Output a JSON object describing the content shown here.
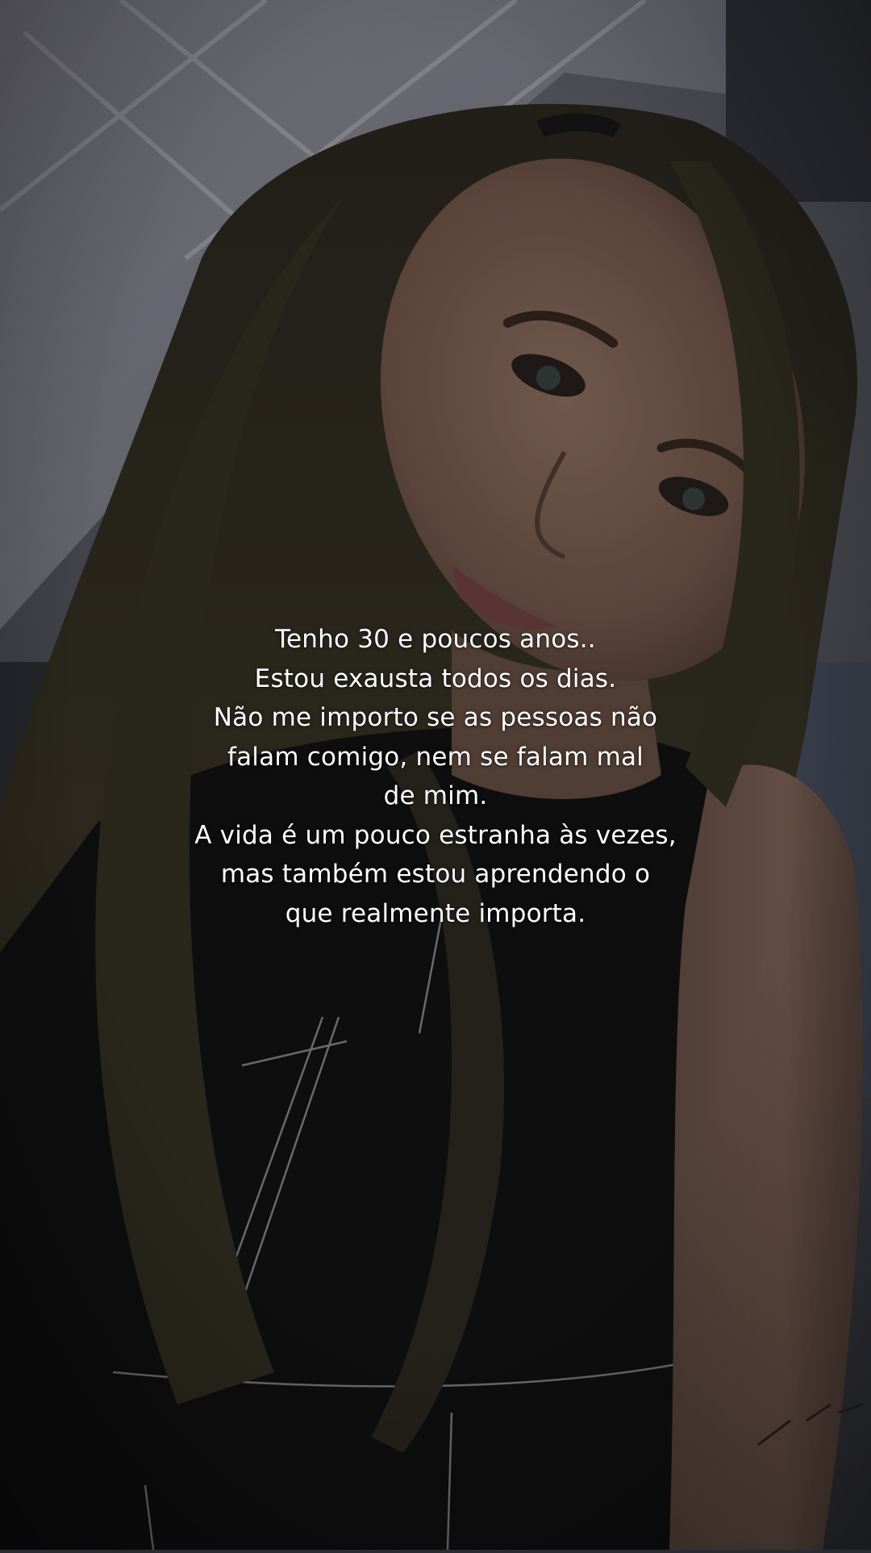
{
  "photo": {
    "subject": "selfie-portrait",
    "colors": {
      "ceiling": "#8e8fa0",
      "wall": "#5e6068",
      "skin": "#8a6a5c",
      "hair": "#3a3528",
      "shirt": "#141416",
      "overlay_tint": "#000000"
    }
  },
  "caption": {
    "lines": [
      "Tenho 30 e poucos anos..",
      "Estou exausta todos os dias.",
      "Não me importo se as pessoas não",
      "falam comigo, nem se falam mal",
      "de mim.",
      "A vida é um pouco estranha às vezes,",
      "mas também estou aprendendo o",
      "que realmente importa."
    ],
    "text_color": "#ffffff"
  }
}
